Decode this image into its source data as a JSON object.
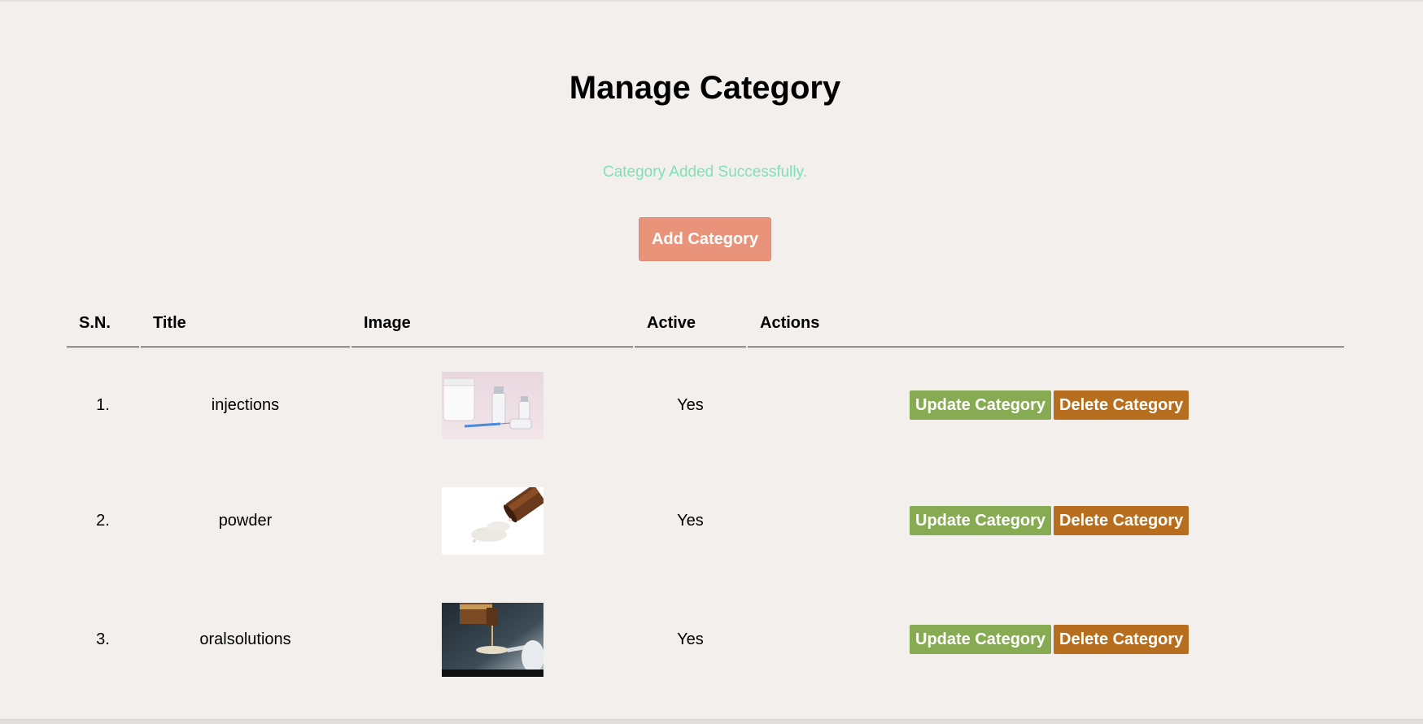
{
  "page": {
    "title": "Manage Category",
    "message": "Category Added Successfully.",
    "add_button": "Add Category"
  },
  "table": {
    "headers": [
      "S.N.",
      "Title",
      "Image",
      "Active",
      "Actions"
    ],
    "rows": [
      {
        "sn": "1.",
        "title": "injections",
        "image": "injections-image",
        "active": "Yes"
      },
      {
        "sn": "2.",
        "title": "powder",
        "image": "powder-image",
        "active": "Yes"
      },
      {
        "sn": "3.",
        "title": "oralsolutions",
        "image": "oralsolutions-image",
        "active": "Yes"
      }
    ],
    "update_label": "Update Category",
    "delete_label": "Delete Category"
  },
  "colors": {
    "background": "#f3efec",
    "success": "#7fe0b8",
    "add_button": "#e9947a",
    "update_button": "#86ab52",
    "delete_button": "#b86e1f"
  }
}
